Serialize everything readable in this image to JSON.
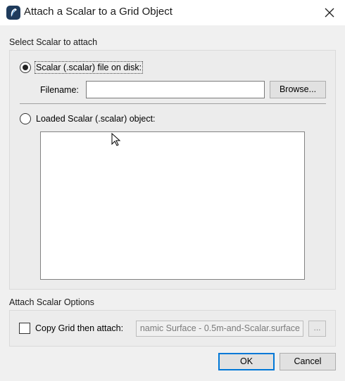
{
  "window": {
    "title": "Attach a Scalar to a Grid Object",
    "icon": "app-logo-icon",
    "close_icon": "close-icon"
  },
  "select_group": {
    "label": "Select Scalar to attach",
    "option_file": {
      "label": "Scalar (.scalar) file on disk:",
      "selected": true
    },
    "filename_label": "Filename:",
    "filename_value": "",
    "browse_label": "Browse...",
    "option_loaded": {
      "label": "Loaded Scalar (.scalar) object:",
      "selected": false
    },
    "loaded_objects": []
  },
  "options_group": {
    "label": "Attach Scalar Options",
    "copy_grid_label": "Copy Grid then attach:",
    "copy_grid_checked": false,
    "copy_grid_value": "namic Surface - 0.5m-and-Scalar.surface",
    "ellipsis_label": "..."
  },
  "footer": {
    "ok_label": "OK",
    "cancel_label": "Cancel"
  },
  "colors": {
    "dialog_bg": "#f0f0f0",
    "default_button_border": "#0078d7"
  }
}
